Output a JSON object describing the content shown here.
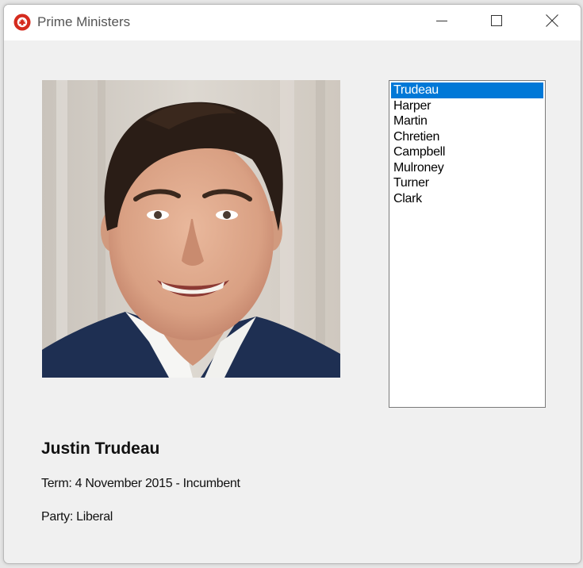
{
  "window": {
    "title": "Prime Ministers",
    "app_icon": "canada-maple-leaf-icon",
    "controls": {
      "minimize_icon": "minimize-icon",
      "maximize_icon": "maximize-icon",
      "close_icon": "close-icon"
    }
  },
  "photo": {
    "icon": "prime-minister-portrait-photo",
    "subject": "Justin Trudeau"
  },
  "listbox": {
    "items": [
      "Trudeau",
      "Harper",
      "Martin",
      "Chretien",
      "Campbell",
      "Mulroney",
      "Turner",
      "Clark"
    ],
    "selected_index": 0,
    "selected_value": "Trudeau",
    "selection_color": "#0078d7"
  },
  "details": {
    "name": "Justin Trudeau",
    "term": "Term: 4 November 2015 - Incumbent",
    "party": "Party: Liberal"
  },
  "colors": {
    "window_background": "#f0f0f0",
    "titlebar_background": "#ffffff",
    "icon_red": "#d52b1e"
  }
}
